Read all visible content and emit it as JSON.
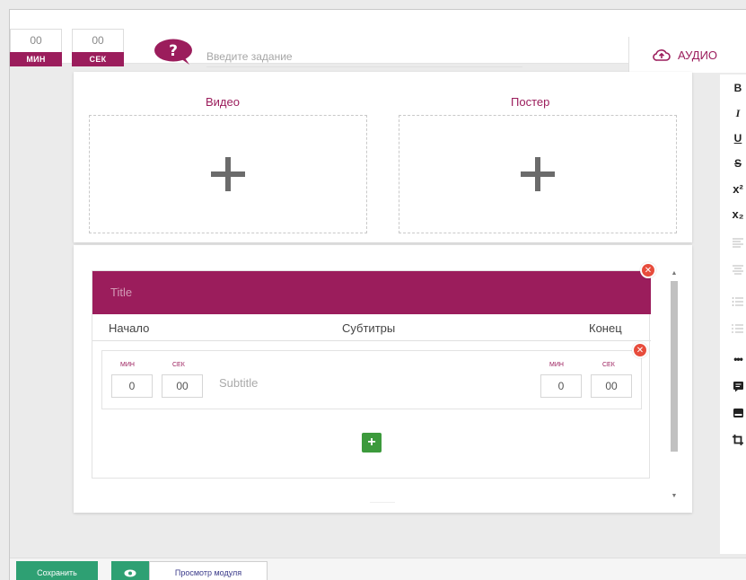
{
  "timers": [
    {
      "value": "00",
      "label": "МИН"
    },
    {
      "value": "00",
      "label": "СЕК"
    }
  ],
  "task": {
    "placeholder": "Введите задание"
  },
  "audio": {
    "label": "АУДИО"
  },
  "media": {
    "video_label": "Видео",
    "poster_label": "Постер"
  },
  "subtitles": {
    "title_placeholder": "Title",
    "columns": {
      "start": "Начало",
      "subtitles": "Субтитры",
      "end": "Конец"
    },
    "row": {
      "start_min_label": "МИН",
      "start_sec_label": "СЕК",
      "start_min": "0",
      "start_sec": "00",
      "text_placeholder": "Subtitle",
      "end_min_label": "МИН",
      "end_sec_label": "СЕК",
      "end_min": "0",
      "end_sec": "00"
    },
    "add_label": "+"
  },
  "toolbar": {
    "bold": "B",
    "italic": "I",
    "underline": "U",
    "strike": "S",
    "superscript": "x²",
    "subscript": "x₂",
    "more": "•••"
  },
  "bottom": {
    "save_label": "Сохранить",
    "preview_label": "Просмотр модуля"
  },
  "colors": {
    "accent": "#9b1d5c",
    "success": "#2ea073",
    "danger": "#e74c3c"
  }
}
